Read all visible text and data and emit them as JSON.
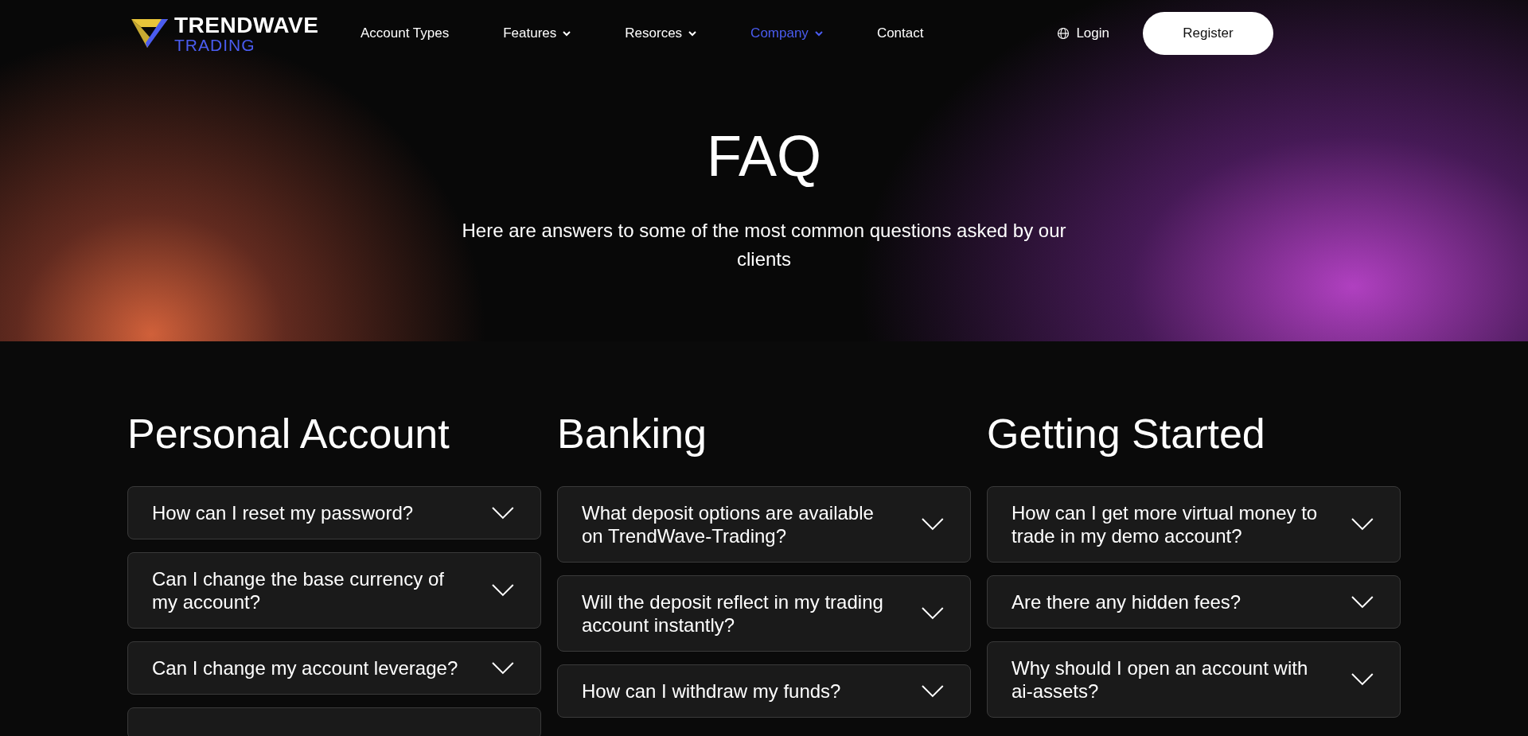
{
  "logo": {
    "line_1": "TRENDWAVE",
    "line_2": "TRADING"
  },
  "nav": [
    {
      "label": "Account Types",
      "dropdown": false,
      "selected": false
    },
    {
      "label": "Features",
      "dropdown": true,
      "selected": false
    },
    {
      "label": "Resorces",
      "dropdown": true,
      "selected": false
    },
    {
      "label": "Company",
      "dropdown": true,
      "selected": true
    },
    {
      "label": "Contact",
      "dropdown": false,
      "selected": false
    }
  ],
  "login": "Login",
  "register": "Register",
  "hero": {
    "title": "FAQ",
    "subtitle": "Here are answers to some of the most common questions asked by our clients"
  },
  "columns": [
    {
      "title": "Personal Account",
      "questions": [
        {
          "text": "How can I reset my password?",
          "expanded": false
        },
        {
          "text": "Can I change the base currency of my account?",
          "expanded": false
        },
        {
          "text": "Can I change my account leverage?",
          "expanded": false
        }
      ],
      "more_below": true
    },
    {
      "title": "Banking",
      "questions": [
        {
          "text": "What deposit options are available on TrendWave-Trading?",
          "expanded": false
        },
        {
          "text": "Will the deposit reflect in my trading account instantly?",
          "expanded": false
        },
        {
          "text": "How can I withdraw my funds?",
          "expanded": false
        }
      ],
      "more_below": false
    },
    {
      "title": "Getting Started",
      "questions": [
        {
          "text": "How can I get more virtual money to trade in my demo account?",
          "expanded": false
        },
        {
          "text": "Are there any hidden fees?",
          "expanded": false
        },
        {
          "text": "Why should I open an account with ai-assets?",
          "expanded": false
        }
      ],
      "more_below": false
    }
  ]
}
